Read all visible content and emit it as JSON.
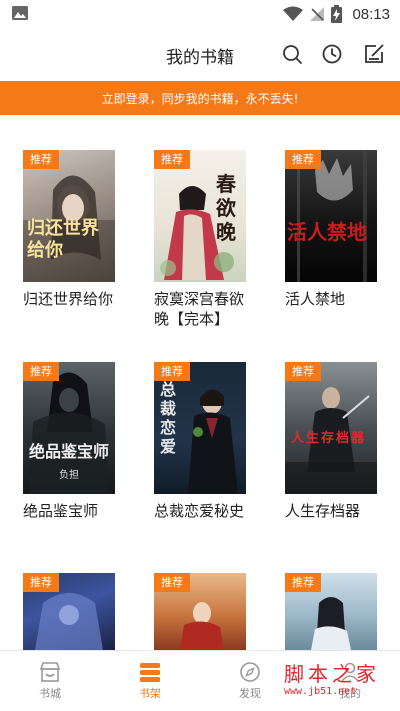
{
  "status_bar": {
    "time": "08:13"
  },
  "header": {
    "title": "我的书籍"
  },
  "banner": {
    "text": "立即登录，同步我的书籍，永不丢失!"
  },
  "books": [
    {
      "tag": "推荐",
      "title": "归还世界给你",
      "cover_text": "归还世界给你"
    },
    {
      "tag": "推荐",
      "title": "寂寞深宫春欲晚【完本】",
      "cover_text": "春欲晚"
    },
    {
      "tag": "推荐",
      "title": "活人禁地",
      "cover_text": "活人禁地"
    },
    {
      "tag": "推荐",
      "title": "绝品鉴宝师",
      "cover_text": "绝品鉴宝师",
      "cover_author": "负担"
    },
    {
      "tag": "推荐",
      "title": "总裁恋爱秘史",
      "cover_text": "总裁恋爱"
    },
    {
      "tag": "推荐",
      "title": "人生存档器",
      "cover_text": "人生存档器"
    },
    {
      "tag": "推荐",
      "title": ""
    },
    {
      "tag": "推荐",
      "title": ""
    },
    {
      "tag": "推荐",
      "title": ""
    }
  ],
  "bottom_nav": [
    {
      "label": "书城",
      "icon": "store-icon"
    },
    {
      "label": "书架",
      "icon": "bookshelf-icon",
      "active": true
    },
    {
      "label": "发现",
      "icon": "compass-icon"
    },
    {
      "label": "我的",
      "icon": "user-icon"
    }
  ],
  "watermark": {
    "title": "脚本之家",
    "url": "www.jb51.net"
  },
  "colors": {
    "accent": "#f57a17"
  }
}
